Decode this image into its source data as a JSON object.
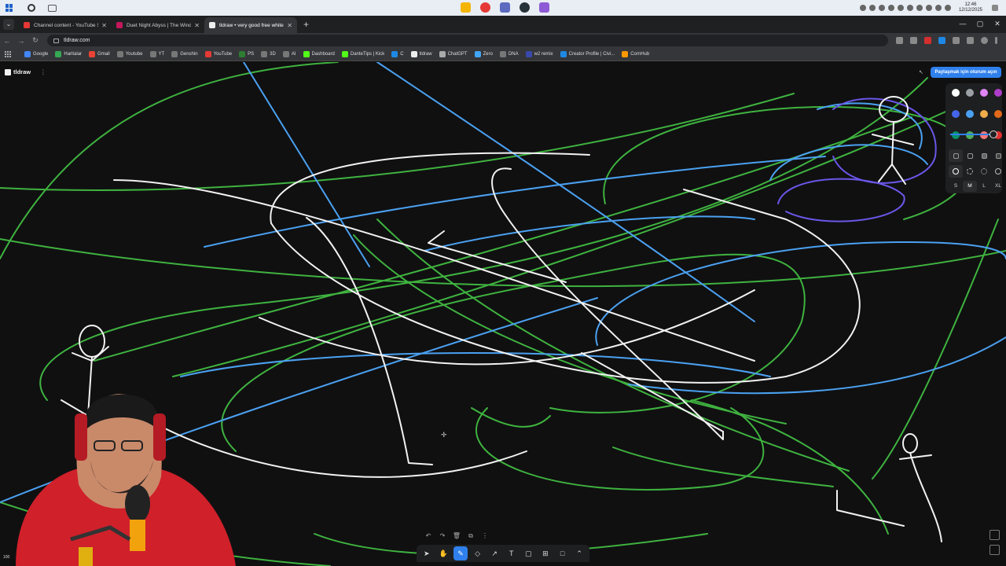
{
  "os": {
    "clock_time": "12:46",
    "clock_date": "12/12/2025"
  },
  "browser": {
    "tabs": [
      {
        "title": "Channel content - YouTube Stu",
        "favicon_color": "#e53935",
        "active": false
      },
      {
        "title": "Duet Night Abyss | The Wind A",
        "favicon_color": "#c2185b",
        "active": false
      },
      {
        "title": "tldraw • very good free whiteb",
        "favicon_color": "#eeeeee",
        "active": true
      }
    ],
    "url": "tldraw.com",
    "bookmarks": [
      {
        "label": "Google",
        "color": "#4285f4"
      },
      {
        "label": "Haritalar",
        "color": "#34a853"
      },
      {
        "label": "Gmail",
        "color": "#ea4335"
      },
      {
        "label": "Youtube",
        "color": "#777777"
      },
      {
        "label": "YT",
        "color": "#777777"
      },
      {
        "label": "Genshin",
        "color": "#777777"
      },
      {
        "label": "YouTube",
        "color": "#e53935"
      },
      {
        "label": "PS",
        "color": "#2e7d32"
      },
      {
        "label": "3D",
        "color": "#777777"
      },
      {
        "label": "AI",
        "color": "#777777"
      },
      {
        "label": "Dashboard",
        "color": "#53fc18"
      },
      {
        "label": "DanteTips | Kick",
        "color": "#53fc18"
      },
      {
        "label": "C",
        "color": "#1e88e5"
      },
      {
        "label": "tldraw",
        "color": "#eeeeee"
      },
      {
        "label": "ChatGPT",
        "color": "#aaaaaa"
      },
      {
        "label": "Zero",
        "color": "#42a5f5"
      },
      {
        "label": "DNA",
        "color": "#777777"
      },
      {
        "label": "w2 remix",
        "color": "#3949ab"
      },
      {
        "label": "Creator Profile | Civi...",
        "color": "#1e88e5"
      },
      {
        "label": "CornHub",
        "color": "#ff9800"
      }
    ]
  },
  "tldraw": {
    "logo": "tldraw",
    "share_button": "Paylaşmak için oturum açın",
    "style_panel": {
      "colors": [
        "#ffffff",
        "#9aa0a6",
        "#e085f4",
        "#ae3ec9",
        "#4465e9",
        "#4ba1f1",
        "#f1ac4b",
        "#e16919",
        "#099268",
        "#4cb05e",
        "#f87777",
        "#e03131"
      ],
      "sizes": [
        "S",
        "M",
        "L",
        "XL"
      ],
      "selected_size": "M"
    },
    "tools": [
      {
        "name": "select",
        "glyph": "➤"
      },
      {
        "name": "hand",
        "glyph": "✋"
      },
      {
        "name": "draw",
        "glyph": "✎"
      },
      {
        "name": "eraser",
        "glyph": "◇"
      },
      {
        "name": "arrow",
        "glyph": "↗"
      },
      {
        "name": "text",
        "glyph": "T"
      },
      {
        "name": "note",
        "glyph": "▢"
      },
      {
        "name": "asset",
        "glyph": "⊞"
      },
      {
        "name": "rectangle",
        "glyph": "□"
      },
      {
        "name": "more",
        "glyph": "⌃"
      }
    ],
    "active_tool": "draw",
    "webcam_zoom": "100"
  }
}
